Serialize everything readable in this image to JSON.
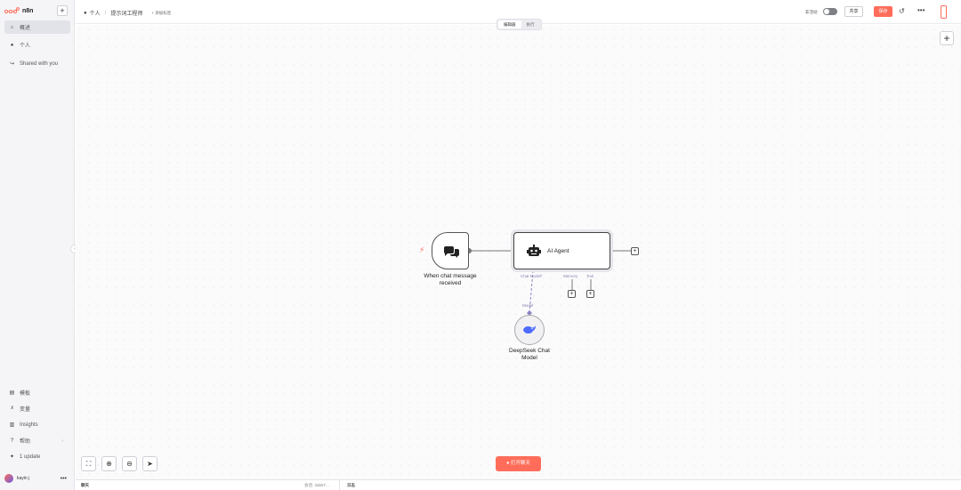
{
  "app": {
    "logo_text": "n8n",
    "accent": "#ff6d5a"
  },
  "sidebar": {
    "new_label": "+",
    "items": [
      {
        "label": "概述",
        "icon": "home-icon",
        "active": true
      },
      {
        "label": "个人",
        "icon": "user-icon",
        "active": false
      },
      {
        "label": "Shared with you",
        "icon": "share-icon",
        "active": false
      }
    ],
    "bottom_items": [
      {
        "label": "模板",
        "icon": "template-icon"
      },
      {
        "label": "变量",
        "icon": "variable-icon"
      },
      {
        "label": "Insights",
        "icon": "chart-icon"
      },
      {
        "label": "帮助",
        "icon": "help-icon"
      },
      {
        "label": "1 update",
        "icon": "gift-icon"
      }
    ],
    "user": {
      "name": "kayin j",
      "menu": "•••"
    }
  },
  "header": {
    "breadcrumb_project": "个人",
    "breadcrumb_sep": "/",
    "workflow_name": "提示词工程师",
    "add_tag": "+ 添加标签",
    "inactive_label": "非活动",
    "share_label": "共享",
    "save_label": "保存",
    "more": "•••"
  },
  "tabs": [
    {
      "label": "编辑器",
      "active": true
    },
    {
      "label": "执行",
      "active": false
    }
  ],
  "canvas": {
    "nodes": {
      "trigger": {
        "label_line1": "When chat message",
        "label_line2": "received"
      },
      "agent": {
        "label": "AI Agent",
        "ports": [
          "Chat Model*",
          "Memory",
          "Tool"
        ]
      },
      "model": {
        "label_line1": "DeepSeek Chat",
        "label_line2": "Model",
        "port": "Model"
      }
    },
    "open_chat_label": "打开聊天"
  },
  "footer": {
    "chat_label": "聊天",
    "session": "会话: 3ab57...",
    "logs_label": "日志"
  }
}
